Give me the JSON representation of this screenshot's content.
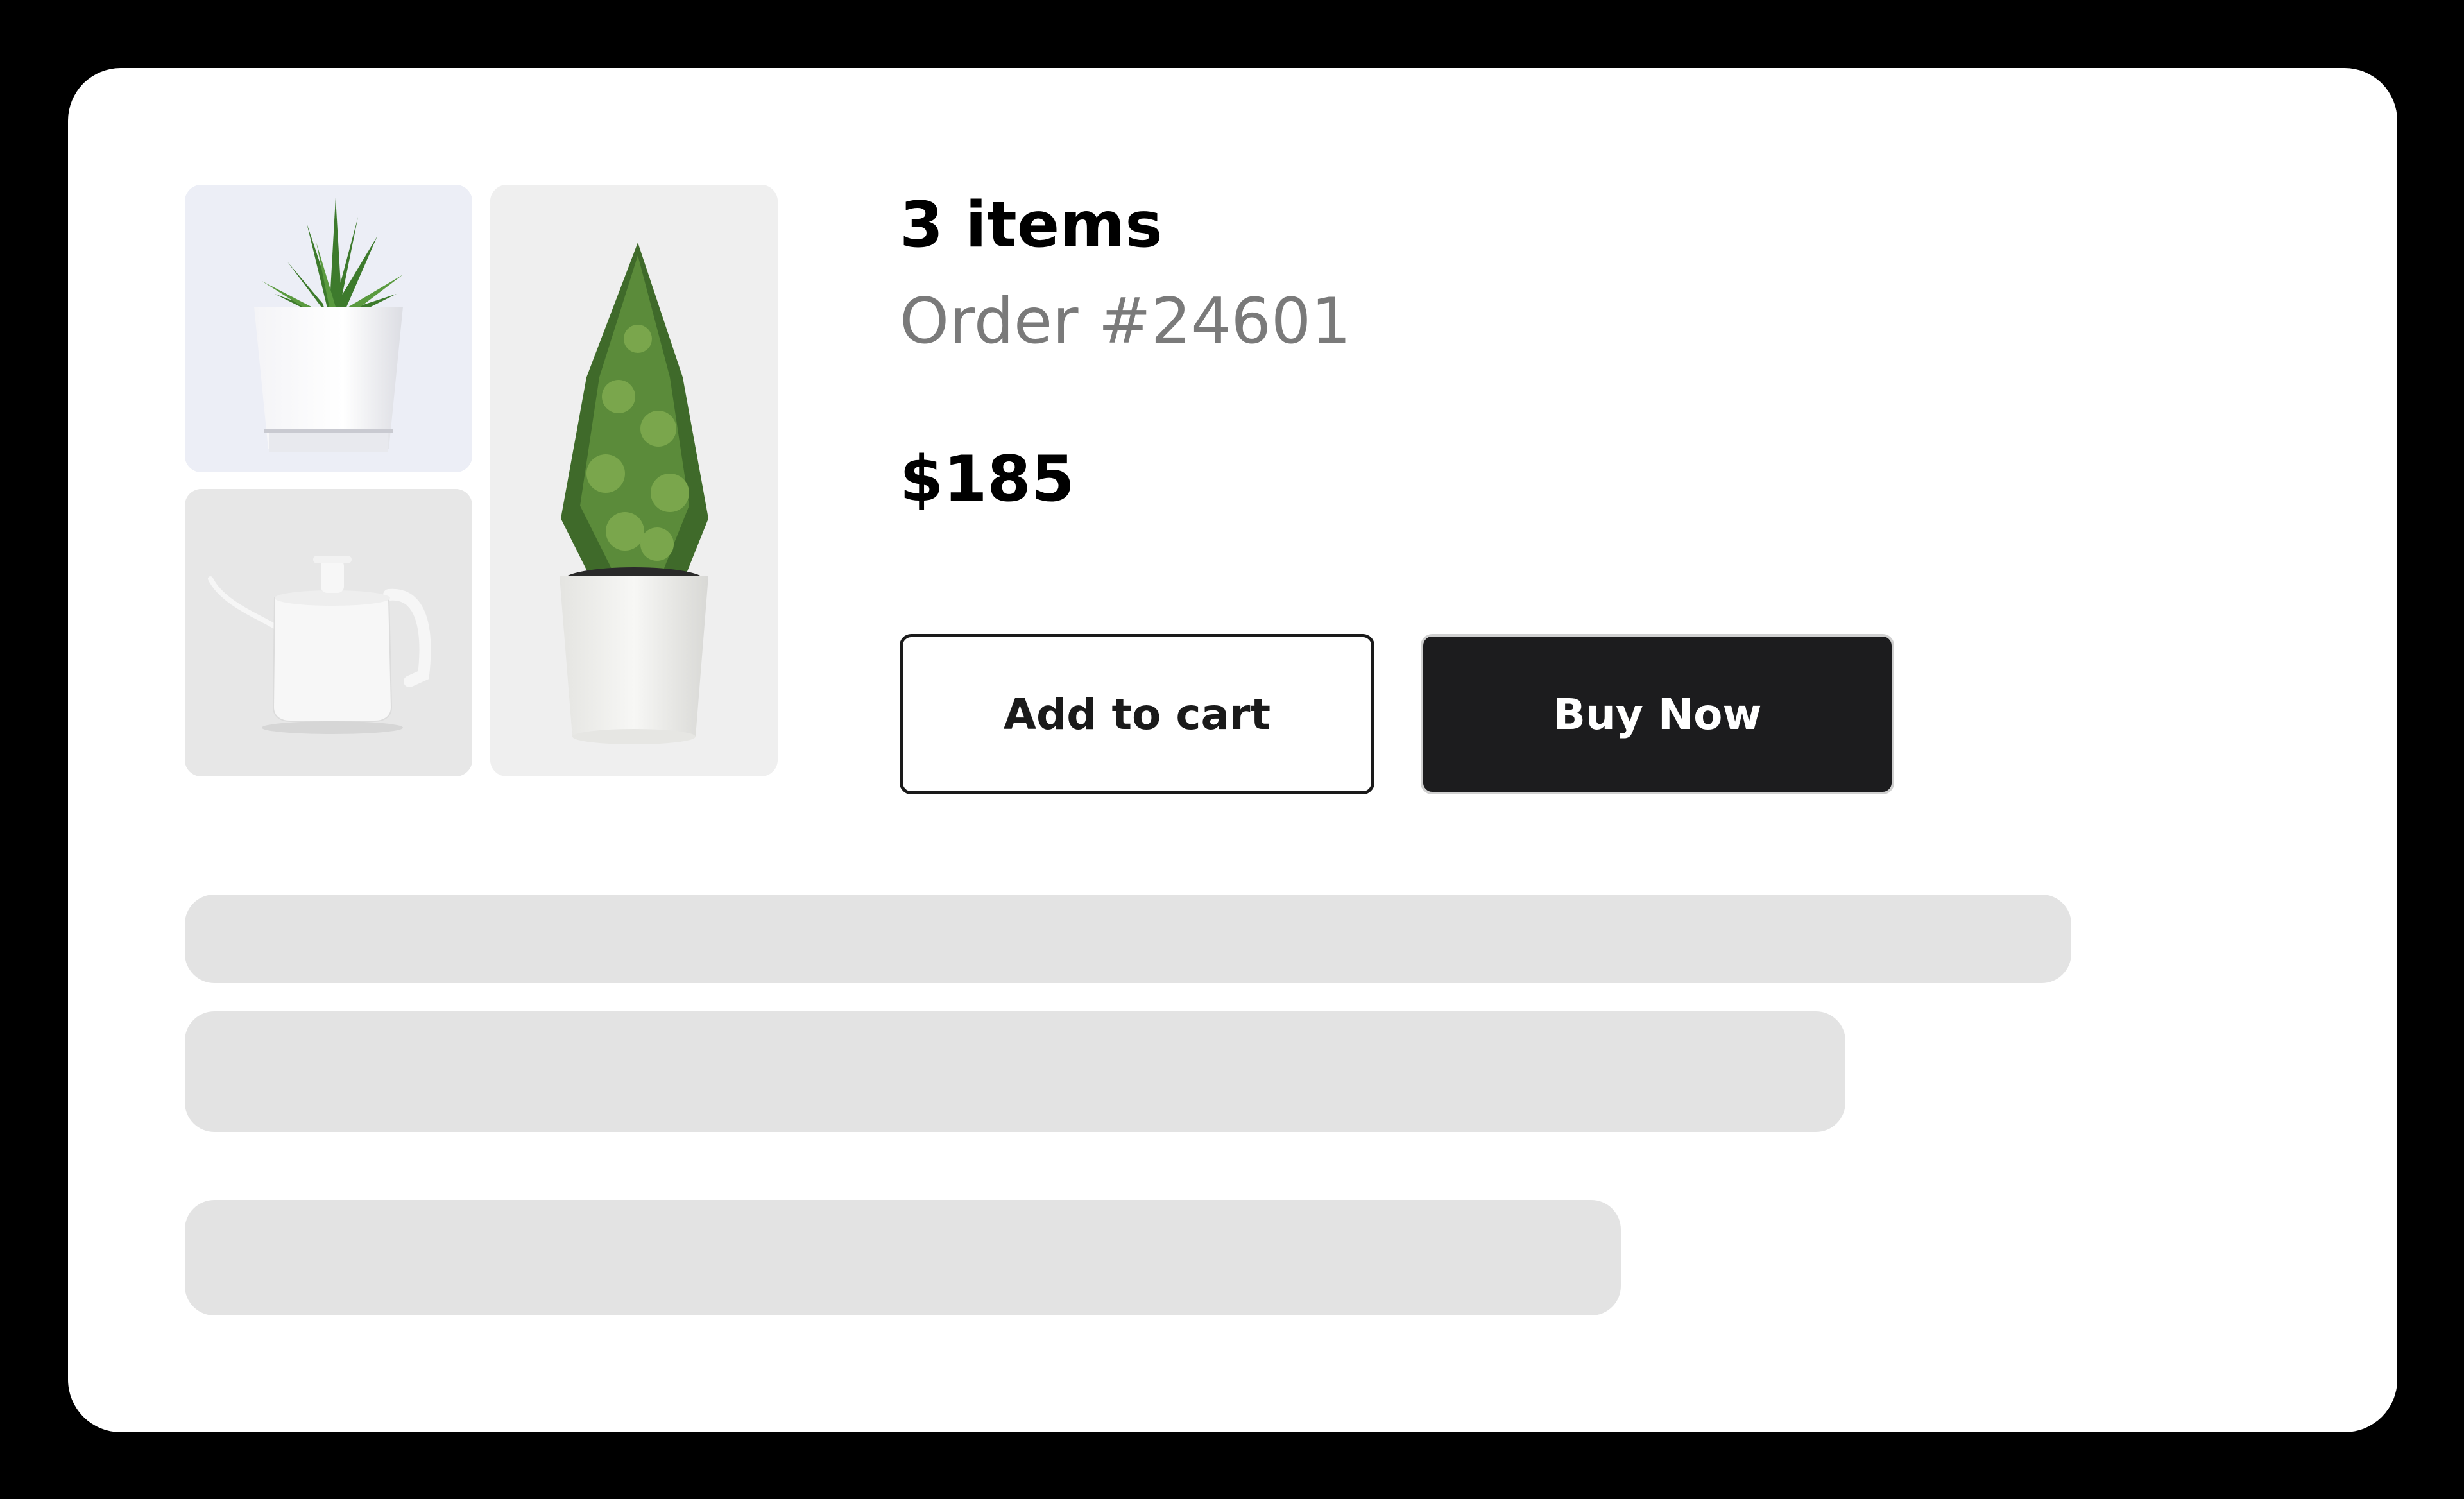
{
  "order": {
    "title": "3 items",
    "number_text": "Order #24601",
    "price": "$185"
  },
  "actions": {
    "add_to_cart_label": "Add to cart",
    "buy_now_label": "Buy Now"
  },
  "products": [
    {
      "icon": "aloe-plant-icon"
    },
    {
      "icon": "kettle-icon"
    },
    {
      "icon": "potted-tree-icon"
    }
  ],
  "colors": {
    "background": "#000000",
    "card": "#ffffff",
    "buy_button": "#1c1c1e",
    "secondary_text": "#7a7a7a",
    "skeleton": "#e3e3e3"
  }
}
